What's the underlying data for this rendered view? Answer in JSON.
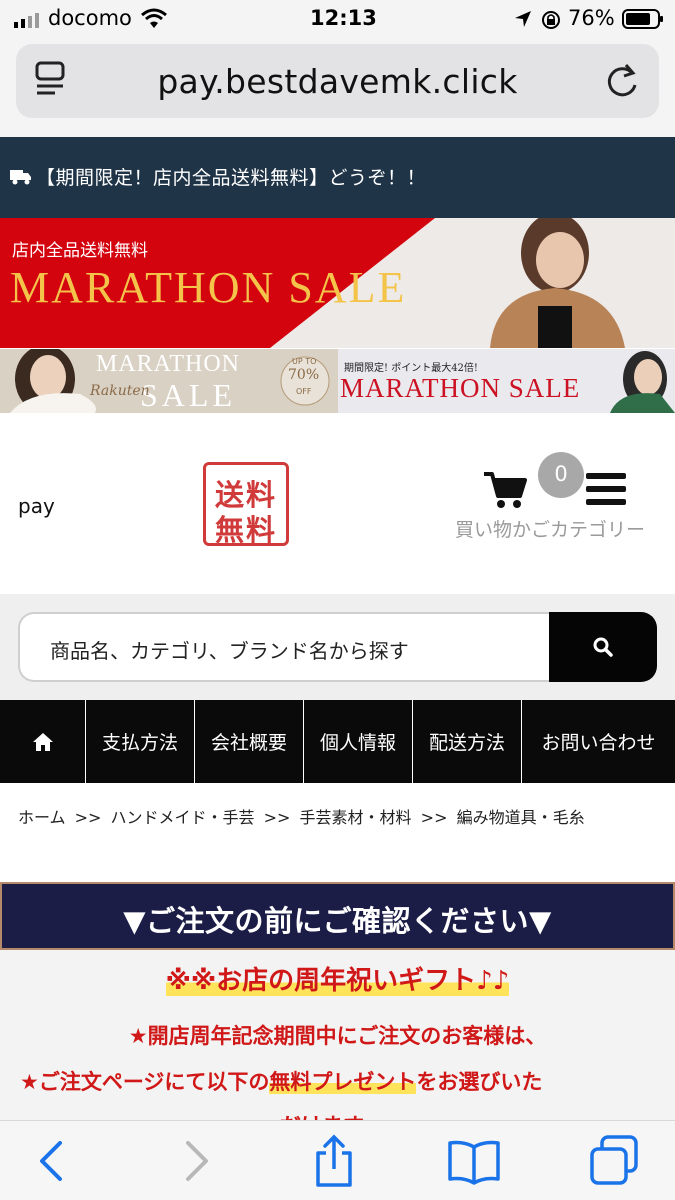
{
  "status_bar": {
    "carrier": "docomo",
    "time": "12:13",
    "battery": "76%"
  },
  "browser": {
    "url": "pay.bestdavemk.click"
  },
  "notice": {
    "text": "【期間限定！店内全品送料無料】どうぞ！！"
  },
  "banner1": {
    "small_text": "店内全品送料無料",
    "title": "MARATHON SALE"
  },
  "banner2": {
    "left_title_1": "MARATHON",
    "left_title_2": "SALE",
    "left_script": "Rakuten",
    "badge_top": "UP TO",
    "badge_value": "70%",
    "badge_suffix": "OFF",
    "right_small": "期間限定! ポイント最大42倍!",
    "right_title": "MARATHON SALE"
  },
  "header": {
    "site_name": "pay",
    "logo_line1": "送料",
    "logo_line2": "無料",
    "cart_count": "0",
    "cart_label": "買い物かご",
    "category_label": "カテゴリー"
  },
  "search": {
    "placeholder": "商品名、カテゴリ、ブランド名から探す"
  },
  "nav": {
    "items": [
      {
        "label": ""
      },
      {
        "label": "支払方法"
      },
      {
        "label": "会社概要"
      },
      {
        "label": "個人情報"
      },
      {
        "label": "配送方法"
      },
      {
        "label": "お問い合わせ"
      }
    ]
  },
  "breadcrumb": {
    "items": [
      "ホーム",
      ">>",
      "ハンドメイド・手芸",
      ">>",
      "手芸素材・材料",
      ">>",
      "編み物道具・毛糸"
    ]
  },
  "notice_box": {
    "heading": "▼ご注文の前にご確認ください▼",
    "gift_title": "※※お店の周年祝いギフト♪♪",
    "line1": "★開店周年記念期間中にご注文のお客様は、",
    "line2_a": "★ご注文ページにて以下の",
    "line2_b": "無料プレゼント",
    "line2_c": "をお選びいた",
    "line3": "だけます"
  },
  "colors": {
    "notice_bg": "#1f3447",
    "nav_bg": "#0a0a0a",
    "accent_red": "#d01818",
    "confirm_bg": "#1b1d46"
  }
}
